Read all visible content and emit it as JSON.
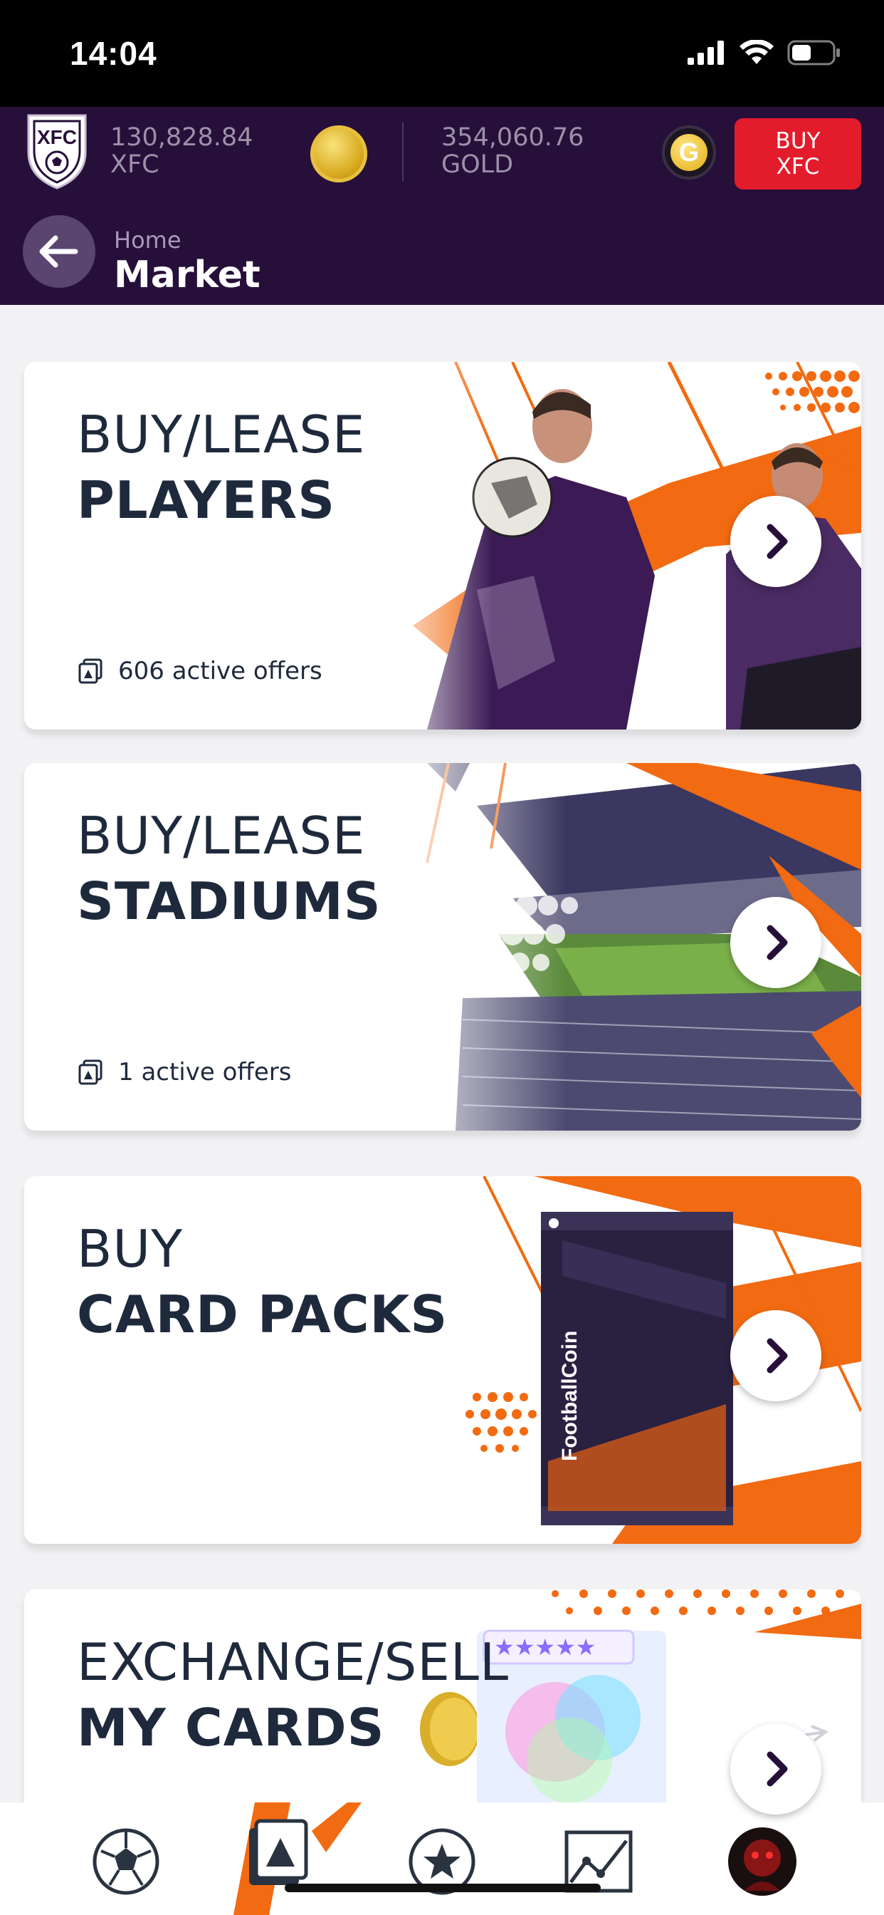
{
  "status_bar": {
    "time": "14:04"
  },
  "header": {
    "xfc_balance": "130,828.84",
    "xfc_unit": "XFC",
    "gold_balance": "354,060.76",
    "gold_unit": "GOLD",
    "buy_button": {
      "line1": "BUY",
      "line2": "XFC"
    },
    "logo_text": "XFC",
    "gold_coin_letter": "G",
    "breadcrumb": "Home",
    "title": "Market"
  },
  "cards": [
    {
      "line1": "BUY/LEASE",
      "line2": "PLAYERS",
      "offers": "606 active offers"
    },
    {
      "line1": "BUY/LEASE",
      "line2": "STADIUMS",
      "offers": "1 active offers"
    },
    {
      "line1": "BUY",
      "line2": "CARD PACKS",
      "pack_text": "FootballCoin"
    },
    {
      "line1": "EXCHANGE/SELL",
      "line2": "MY CARDS"
    }
  ],
  "colors": {
    "header_bg": "#26103a",
    "accent_orange": "#f26a11",
    "buy_red": "#e31c2c",
    "text_dark": "#1e2a3c",
    "purple": "#3b1a55"
  },
  "bottom_nav": [
    "soccer-ball-icon",
    "market-icon",
    "star-icon",
    "stats-icon",
    "profile-avatar"
  ]
}
